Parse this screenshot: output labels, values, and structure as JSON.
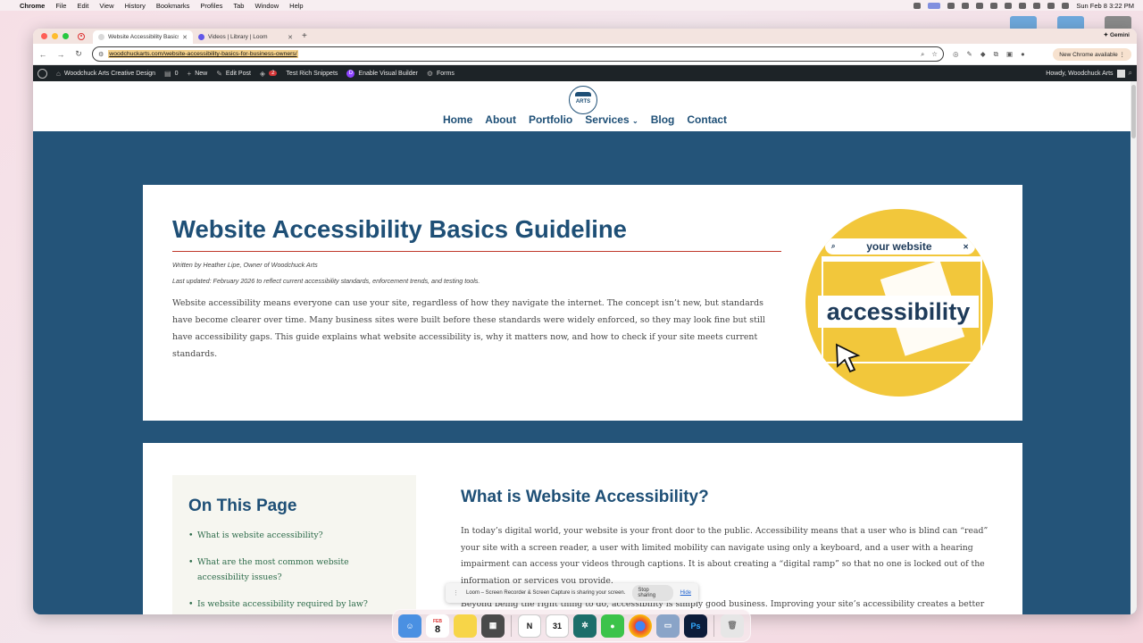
{
  "menubar": {
    "app_name": "Chrome",
    "items": [
      "File",
      "Edit",
      "View",
      "History",
      "Bookmarks",
      "Profiles",
      "Tab",
      "Window",
      "Help"
    ],
    "datetime": "Sun Feb 8  3:22 PM"
  },
  "browser": {
    "tabs": [
      {
        "title": "Website Accessibility Basics",
        "favicon_color": "#d9d9d9"
      },
      {
        "title": "Videos | Library | Loom",
        "favicon_color": "#6257e8"
      }
    ],
    "gemini_label": "Gemini",
    "url": "woodchuckarts.com/website-accessibility-basics-for-business-owners/",
    "update_label": "New Chrome available"
  },
  "wp_admin_bar": {
    "site_name": "Woodchuck Arts Creative Design",
    "comments_count": "0",
    "new_label": "New",
    "edit_label": "Edit Post",
    "seo_badge": "2",
    "rich_snippets_label": "Test Rich Snippets",
    "visual_builder_label": "Enable Visual Builder",
    "forms_label": "Forms",
    "howdy_label": "Howdy, Woodchuck Arts"
  },
  "site": {
    "logo_text": "ARTS",
    "nav": [
      "Home",
      "About",
      "Portfolio",
      "Services",
      "Blog",
      "Contact"
    ]
  },
  "article": {
    "title": "Website Accessibility Basics Guideline",
    "byline": "Written by Heather Lipe, Owner of Woodchuck Arts",
    "updated": "Last updated: February 2026 to reflect current accessibility standards, enforcement trends, and testing tools.",
    "intro": "Website accessibility means everyone can use your site, regardless of how they navigate the internet. The concept isn’t new, but standards have become clearer over time. Many business sites were built before these standards were widely enforced, so they may look fine but still have accessibility gaps. This guide explains what website accessibility is, why it matters now, and how to check if your site meets current standards.",
    "hero": {
      "search_text": "your website",
      "word": "accessibility"
    }
  },
  "toc": {
    "heading": "On This Page",
    "items": [
      "What is website accessibility?",
      "What are the most common website accessibility issues?",
      "Is website accessibility required by law?"
    ]
  },
  "section": {
    "heading": "What is Website Accessibility?",
    "p1": "In today’s digital world, your website is your front door to the public. Accessibility means that a user who is blind can “read” your site with a screen reader, a user with limited mobility can navigate using only a keyboard, and a user with a hearing impairment can access your videos through captions. It is about creating a “digital ramp” so that no one is locked out of the information or services you provide.",
    "p2": "Beyond being the right thing to do, accessibility is simply good business. Improving your site’s accessibility creates a better experience"
  },
  "loom": {
    "message": "Loom – Screen Recorder & Screen Capture is sharing your screen.",
    "stop_label": "Stop sharing",
    "hide_label": "Hide"
  },
  "dock": {
    "calendar_month": "FEB",
    "calendar_day": "8",
    "calendar2_day": "31",
    "ps_label": "Ps",
    "notion_label": "N"
  },
  "colors": {
    "brand_blue": "#1e4f76",
    "band_blue": "#245479",
    "toc_link": "#2d6b4a",
    "rule_red": "#c0392b",
    "hero_yellow": "#f2c73b"
  }
}
